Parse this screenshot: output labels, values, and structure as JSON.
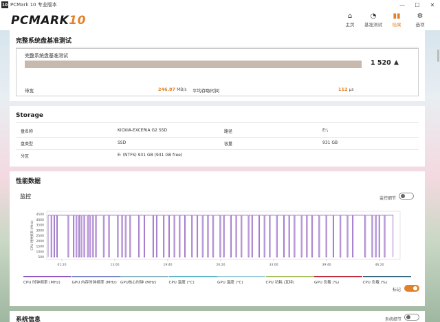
{
  "window": {
    "app_icon": "10",
    "title": "PCMark 10 专业版本",
    "controls": [
      "—",
      "☐",
      "✕"
    ]
  },
  "logo": {
    "main": "PCMARK",
    "num": "10"
  },
  "nav": [
    {
      "label": "主页",
      "icon": "home-icon",
      "glyph": "⌂"
    },
    {
      "label": "基准测试",
      "icon": "gauge-icon",
      "glyph": "◔"
    },
    {
      "label": "结果",
      "icon": "bar-chart-icon",
      "glyph": "▮▮"
    },
    {
      "label": "选项",
      "icon": "gear-icon",
      "glyph": "⚙"
    }
  ],
  "benchmark": {
    "title": "完整系统盘基准测试",
    "sub_title": "完整系统盘基准测试",
    "score": "1 520",
    "bandwidth_label": "带宽",
    "bandwidth_value": "246.87",
    "bandwidth_unit": "MB/s",
    "latency_label": "平均存取时间",
    "latency_value": "112",
    "latency_unit": "μs"
  },
  "storage": {
    "title": "Storage",
    "disk_name_label": "盘名称",
    "disk_name": "KIOXIA-EXCERIA G2 SSD",
    "path_label": "路径",
    "path": "E:\\",
    "disk_type_label": "盘类型",
    "disk_type": "SSD",
    "capacity_label": "容量",
    "capacity": "931 GB",
    "partition_label": "分区",
    "partition": "E: (NTFS) 931 GB (931 GB free)"
  },
  "performance": {
    "title": "性能数据",
    "monitor_label": "监控",
    "detail_toggle_label": "监控细节",
    "mark_label": "标记",
    "legend": [
      {
        "label": "CPU 时钟频率 (MHz)",
        "color": "#8e5bc0"
      },
      {
        "label": "GPU 内存时钟频率 (MHz)",
        "color": "#7a86c8"
      },
      {
        "label": "GPU核心时钟 (MHz)",
        "color": "#8ab4c0"
      },
      {
        "label": "CPU 温度 (°C)",
        "color": "#62b6c8"
      },
      {
        "label": "GPU 温度 (°C)",
        "color": "#9ecbd6"
      },
      {
        "label": "CPU 功耗 (瓦特)",
        "color": "#a8c060"
      },
      {
        "label": "GPU 负载 (%)",
        "color": "#c03040"
      },
      {
        "label": "CPU 负载 (%)",
        "color": "#3a6a80"
      }
    ]
  },
  "chart_data": {
    "type": "line",
    "ylabel": "CPU 时钟频率 (MHz)",
    "y_ticks": [
      "4500",
      "4000",
      "3500",
      "3000",
      "2500",
      "2000",
      "1500",
      "1000",
      "500"
    ],
    "x_ticks": [
      "01:20",
      "13:00",
      "19:40",
      "26:20",
      "33:00",
      "39:40",
      "46:20"
    ],
    "series": [
      {
        "name": "CPU 时钟频率 (MHz)",
        "color": "#8e5bc0"
      }
    ],
    "drops": [
      0.012,
      0.02,
      0.028,
      0.06,
      0.075,
      0.083,
      0.09,
      0.097,
      0.105,
      0.115,
      0.122,
      0.13,
      0.138,
      0.16,
      0.175,
      0.2,
      0.212,
      0.222,
      0.235,
      0.26,
      0.275,
      0.3,
      0.31,
      0.33,
      0.345,
      0.36,
      0.375,
      0.39,
      0.41,
      0.425,
      0.44,
      0.455,
      0.47,
      0.49,
      0.5,
      0.52,
      0.535,
      0.55,
      0.57,
      0.58,
      0.6,
      0.615,
      0.63,
      0.65,
      0.67,
      0.685,
      0.7,
      0.72,
      0.735,
      0.75,
      0.77,
      0.79,
      0.81,
      0.83,
      0.85,
      0.865,
      0.9,
      0.92,
      0.93,
      0.94,
      0.955
    ],
    "baseline_mhz": 4350,
    "drop_mhz": 700,
    "ylim": [
      500,
      4700
    ]
  },
  "system_info": {
    "title": "系统信息",
    "detail_toggle_label": "系统细节"
  }
}
